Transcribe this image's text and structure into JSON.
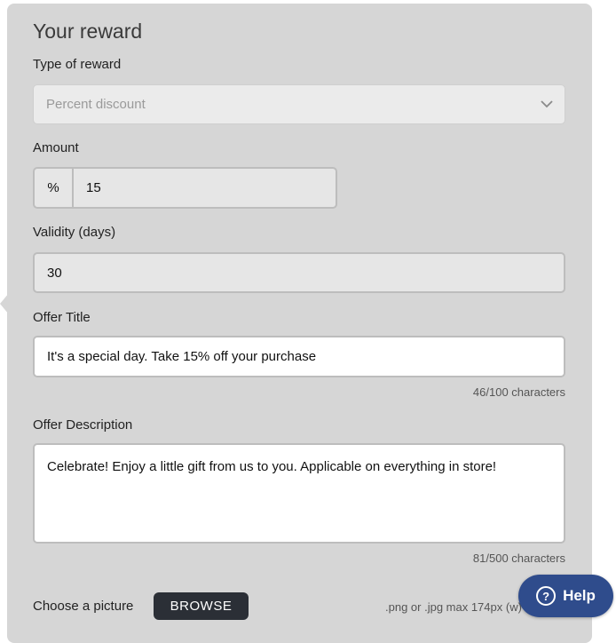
{
  "section": {
    "title": "Your reward"
  },
  "reward_type": {
    "label": "Type of reward",
    "value": "Percent discount"
  },
  "amount": {
    "label": "Amount",
    "prefix": "%",
    "value": "15"
  },
  "validity": {
    "label": "Validity (days)",
    "value": "30"
  },
  "offer_title": {
    "label": "Offer Title",
    "value": "It's a special day. Take 15% off your purchase",
    "counter": "46/100 characters"
  },
  "offer_description": {
    "label": "Offer Description",
    "value": "Celebrate! Enjoy a little gift from us to you. Applicable on everything in store!",
    "counter": "81/500 characters"
  },
  "picture": {
    "label": "Choose a picture",
    "browse_label": "BROWSE",
    "hint": ".png or .jpg max 174px (w) x"
  },
  "help": {
    "label": "Help",
    "icon": "question-circle-icon",
    "color": "#2f4c8c"
  },
  "colors": {
    "card_bg": "#d6d6d6",
    "button_dark": "#2b2f36"
  }
}
